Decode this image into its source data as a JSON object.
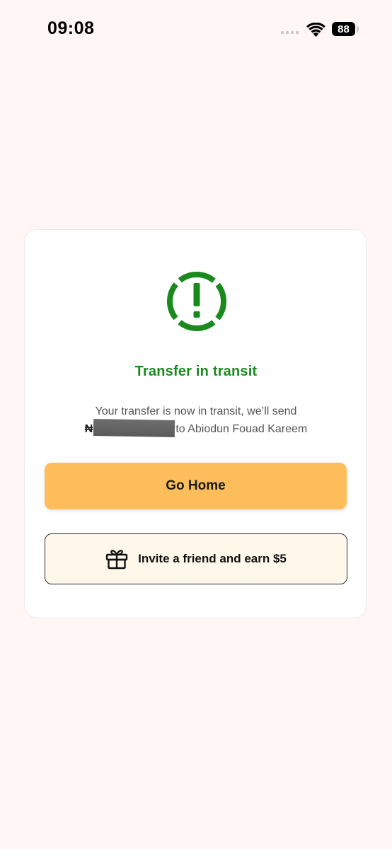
{
  "status_bar": {
    "time": "09:08",
    "battery": "88"
  },
  "transfer": {
    "title": "Transfer in transit",
    "message_line1": "Your transfer is now in transit, we’ll send",
    "currency_symbol": "₦",
    "message_line2_suffix": "to Abiodun Fouad Kareem",
    "status_color": "#1a8a1f",
    "icon": "alert-dashed-circle-icon"
  },
  "actions": {
    "go_home_label": "Go Home",
    "go_home_color": "#fdbd5a",
    "invite_label": "Invite a friend and earn $5",
    "invite_icon": "gift-icon"
  }
}
